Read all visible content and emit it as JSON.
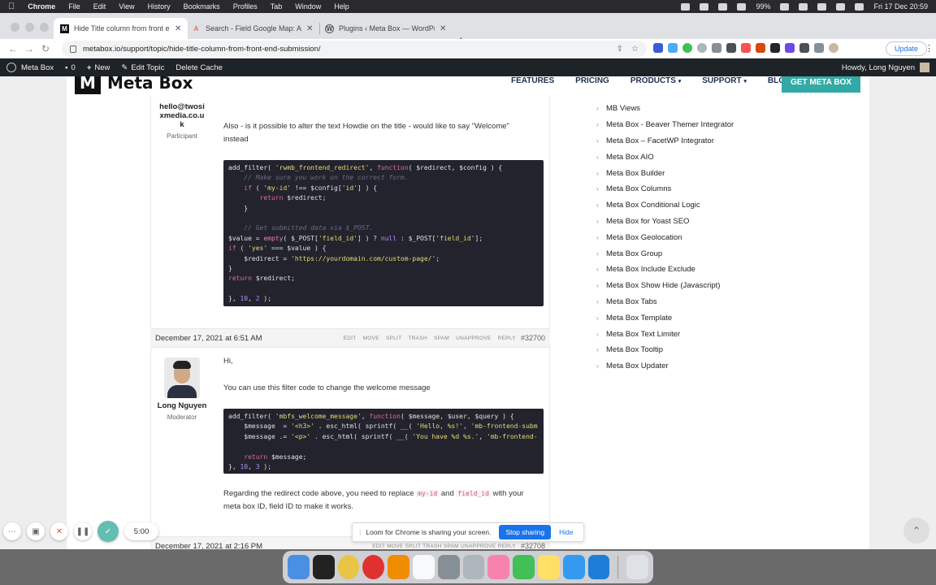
{
  "menubar": {
    "app": "Chrome",
    "items": [
      "File",
      "Edit",
      "View",
      "History",
      "Bookmarks",
      "Profiles",
      "Tab",
      "Window",
      "Help"
    ],
    "battery": "99%",
    "datetime": "Fri 17 Dec  20:59"
  },
  "tabs": [
    {
      "title": "Hide Title column from front e",
      "favicon": "M"
    },
    {
      "title": "Search - Field Google Map: API",
      "favicon": "A"
    },
    {
      "title": "Plugins ‹ Meta Box — WordPress",
      "favicon": "W"
    }
  ],
  "url": "metabox.io/support/topic/hide-title-column-from-front-end-submission/",
  "update_label": "Update",
  "wpbar": {
    "site": "Meta Box",
    "comments": "0",
    "new": "New",
    "edit_topic": "Edit Topic",
    "delete_cache": "Delete Cache",
    "howdy": "Howdy, Long Nguyen"
  },
  "site": {
    "logo_letter": "M",
    "logo_text": "Meta Box",
    "nav": [
      "FEATURES",
      "PRICING",
      "PRODUCTS",
      "SUPPORT",
      "BLOG"
    ],
    "cta": "GET META BOX"
  },
  "reply1": {
    "author_email": "hello@twosixmedia.co.uk",
    "email_l1": "hello@twosi",
    "email_l2": "xmedia.co.u",
    "email_l3": "k",
    "role": "Participant",
    "text1": "Also - is it possible to alter the text Howdie on the title - would like to say \"Welcome\"",
    "text2": "instead"
  },
  "reply2": {
    "date": "December 17, 2021 at 6:51 AM",
    "actions": [
      "EDIT",
      "MOVE",
      "SPLIT",
      "TRASH",
      "SPAM",
      "UNAPPROVE",
      "REPLY"
    ],
    "id": "#32700",
    "author": "Long Nguyen",
    "role": "Moderator",
    "hi": "Hi,",
    "text1": "You can use this filter code to change the welcome message",
    "text2a": "Regarding the redirect code above, you need to replace",
    "code_a": "my-id",
    "and": "and",
    "code_b": "field_id",
    "text2b": "with your",
    "text2c": "meta box ID, field ID to make it works."
  },
  "reply3": {
    "date": "December 17, 2021 at 2:16 PM",
    "actions": "EDIT  MOVE  SPLIT  TRASH  SPAM  UNAPPROVE  REPLY",
    "id": "#32708"
  },
  "sidebar": [
    "MB Views",
    "Meta Box - Beaver Themer Integrator",
    "Meta Box – FacetWP Integrator",
    "Meta Box AIO",
    "Meta Box Builder",
    "Meta Box Columns",
    "Meta Box Conditional Logic",
    "Meta Box for Yoast SEO",
    "Meta Box Geolocation",
    "Meta Box Group",
    "Meta Box Include Exclude",
    "Meta Box Show Hide (Javascript)",
    "Meta Box Tabs",
    "Meta Box Template",
    "Meta Box Text Limiter",
    "Meta Box Tooltip",
    "Meta Box Updater"
  ],
  "loom": {
    "timer": "5:00",
    "message": "Loom for Chrome is sharing your screen.",
    "stop": "Stop sharing",
    "hide": "Hide"
  }
}
